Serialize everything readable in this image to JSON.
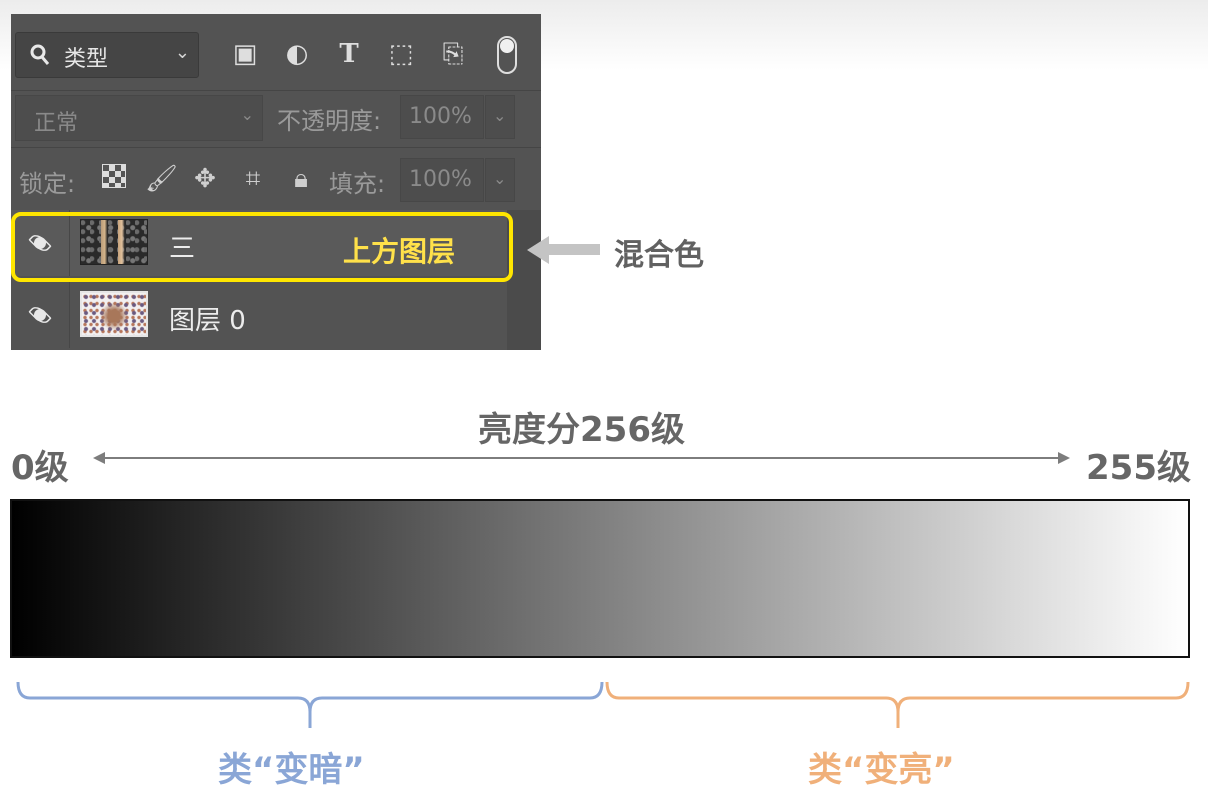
{
  "panel": {
    "filter": {
      "icon": "search-icon",
      "label": "类型",
      "chevron": "⌄"
    },
    "filter_icons": [
      {
        "name": "image-filter-icon",
        "glyph": "▣"
      },
      {
        "name": "adjustment-filter-icon",
        "glyph": "◐"
      },
      {
        "name": "type-filter-icon",
        "glyph": "T"
      },
      {
        "name": "shape-filter-icon",
        "glyph": "⬚"
      },
      {
        "name": "smart-object-filter-icon",
        "glyph": "⎘"
      }
    ],
    "blend_mode": "正常",
    "opacity_label": "不透明度:",
    "opacity_value": "100%",
    "lock_label": "锁定:",
    "fill_label": "填充:",
    "fill_value": "100%",
    "layers": [
      {
        "name": "三",
        "visible": true,
        "highlight_label": "上方图层"
      },
      {
        "name": "图层 0",
        "visible": true
      }
    ]
  },
  "annotations": {
    "blend_color_label": "混合色",
    "axis_title": "亮度分256级",
    "axis_start": "0级",
    "axis_end": "255级",
    "dark_group": "类“变暗”",
    "light_group": "类“变亮”"
  },
  "colors": {
    "highlight": "#ffe600",
    "dark_group": "#8aa6d6",
    "light_group": "#f0b07a",
    "gradient_start": "#000000",
    "gradient_end": "#ffffff"
  }
}
